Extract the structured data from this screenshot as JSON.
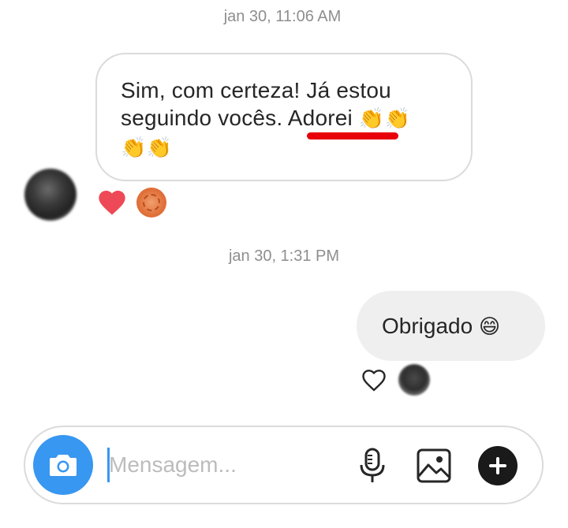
{
  "conversation": {
    "timestamp_1": "jan 30, 11:06 AM",
    "incoming_line_1": "Sim, com certeza! Já estou",
    "incoming_line_2_prefix": "seguindo vocês. ",
    "incoming_highlight": "Adorei",
    "incoming_emoji_1": "👏👏",
    "incoming_emoji_2": "👏👏",
    "incoming_reactions": [
      "heart-filled",
      "avatar"
    ],
    "timestamp_2": "jan 30, 1:31 PM",
    "outgoing_text": "Obrigado",
    "outgoing_emoji": "😄",
    "colors": {
      "heart": "#ed4956",
      "accent": "#3897f0",
      "highlight_line": "#e8000a"
    }
  },
  "composer": {
    "placeholder": "Mensagem...",
    "icons": [
      "camera-icon",
      "microphone-icon",
      "image-icon",
      "plus-icon"
    ]
  }
}
